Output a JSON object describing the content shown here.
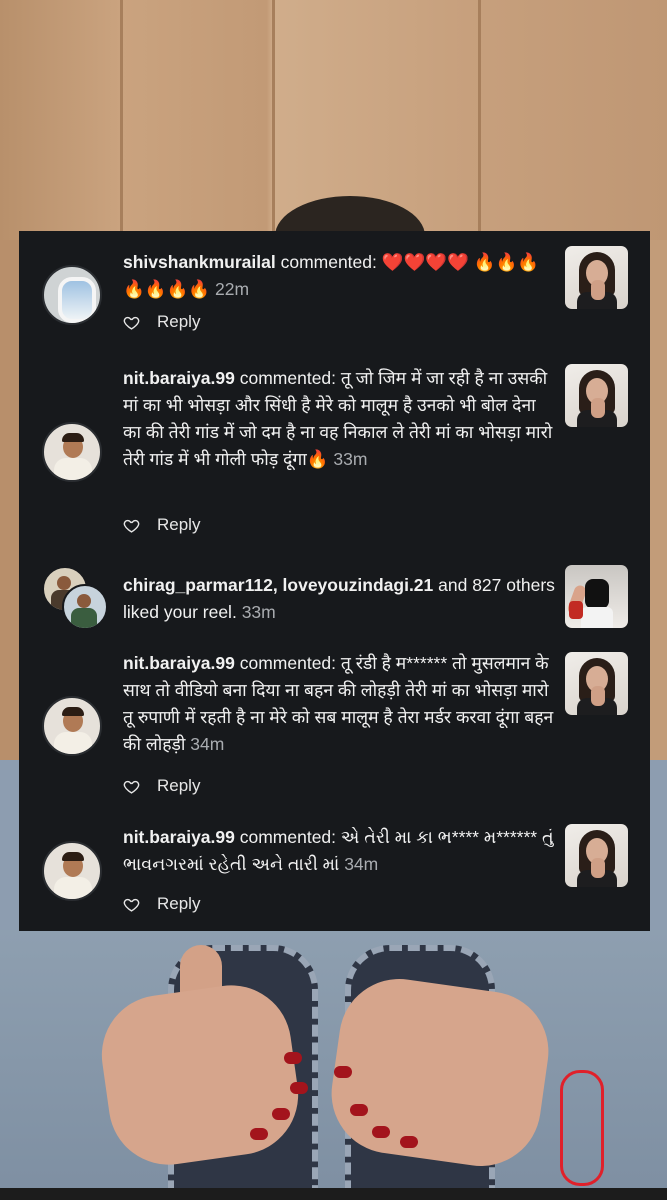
{
  "notifications": [
    {
      "type": "comment",
      "username": "shivshankmurailal",
      "action": " commented: ",
      "comment": "❤️❤️❤️❤️ 🔥🔥🔥🔥🔥🔥🔥",
      "time": "22m",
      "reply_label": "Reply"
    },
    {
      "type": "comment",
      "username": "nit.baraiya.99",
      "action": " commented: ",
      "comment": "तू जो जिम में जा रही है ना उसकी मां का भी भोसड़ा और सिंधी है मेरे को मालूम है उनको भी बोल देना का की तेरी गांड में जो दम है ना वह निकाल ले तेरी मां का भोसड़ा मारो तेरी गांड में भी गोली फोड़ दूंगा🔥",
      "time": "33m",
      "reply_label": "Reply"
    },
    {
      "type": "like",
      "usernames": "chirag_parmar112, loveyouzindagi.21",
      "rest": " and 827 others liked your reel.",
      "time": "33m"
    },
    {
      "type": "comment",
      "username": "nit.baraiya.99",
      "action": " commented: ",
      "comment": "तू रंडी है म****** तो मुसलमान के साथ तो वीडियो बना दिया ना बहन की लोहड़ी तेरी मां का भोसड़ा मारो तू रुपाणी में रहती है ना मेरे को सब मालूम है तेरा मर्डर करवा दूंगा बहन की लोहड़ी",
      "time": "34m",
      "reply_label": "Reply"
    },
    {
      "type": "comment",
      "username": "nit.baraiya.99",
      "action": " commented: ",
      "comment": "એ તેરી મા કા ભ**** મ****** તું ભાવનગરમાં રહેતી અને તારી માં",
      "time": "34m",
      "reply_label": "Reply"
    }
  ],
  "icons": {
    "reply_icon": "heart-outline-icon",
    "avatar_icon": "user-avatar-icon",
    "reel_icon": "reel-thumbnail-icon"
  },
  "colors": {
    "card_bg": "#17191c",
    "text": "#f1f1f1",
    "time": "#a9acb0"
  }
}
